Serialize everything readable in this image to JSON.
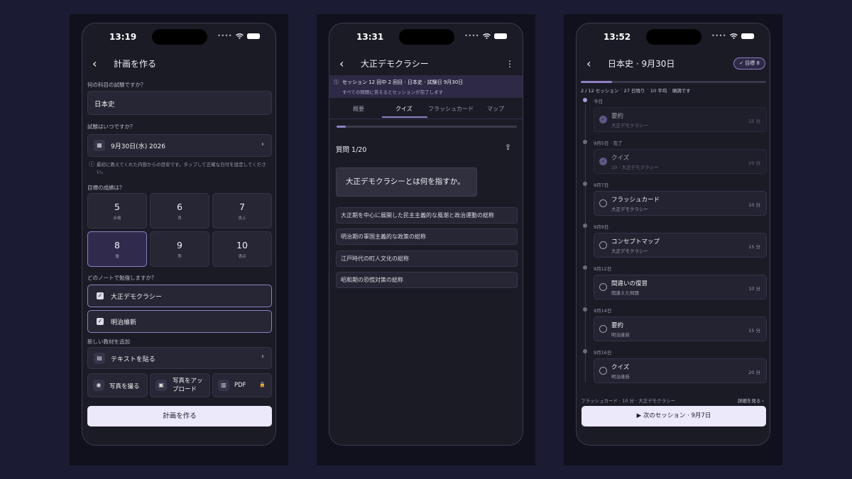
{
  "status": {
    "times": [
      "13:19",
      "13:31",
      "13:52"
    ]
  },
  "screen1": {
    "title": "計画を作る",
    "q_subject": "何の科目の試験ですか？",
    "subject_value": "日本史",
    "q_date": "試験はいつですか？",
    "date_value": "9月30日(水) 2026",
    "date_note": "最初に教えてくれた内容からの目安です。タップして正確な日付を設定してください。",
    "q_goal": "目標の成績は？",
    "grades": [
      {
        "num": "5",
        "label": "合格"
      },
      {
        "num": "6",
        "label": "良"
      },
      {
        "num": "7",
        "label": "良上"
      },
      {
        "num": "8",
        "label": "優"
      },
      {
        "num": "9",
        "label": "秀"
      },
      {
        "num": "10",
        "label": "満点"
      }
    ],
    "q_notes": "どのノートで勉強しますか？",
    "notes": [
      "大正デモクラシー",
      "明治維新"
    ],
    "add_label": "新しい教材を追加",
    "paste_text": "テキストを貼る",
    "photo_take": "写真を撮る",
    "photo_upload": "写真をアップロード",
    "pdf": "PDF",
    "create_button": "計画を作る"
  },
  "screen2": {
    "title": "大正デモクラシー",
    "banner_title": "セッション 12 回中 2 回目 · 日本史 · 試験日 9月30日",
    "banner_sub": "すべての問題に答えるとセッションが完了します",
    "tabs": [
      "概要",
      "クイズ",
      "フラッシュカード",
      "マップ"
    ],
    "progress": 0.05,
    "question_counter": "質問 1/20",
    "question": "大正デモクラシーとは何を指すか。",
    "options": [
      "大正期を中心に展開した民主主義的な風潮と政治運動の総称",
      "明治期の軍国主義的な政策の総称",
      "江戸時代の町人文化の総称",
      "昭和期の恐慌対策の総称"
    ]
  },
  "screen3": {
    "title": "日本史 · 9月30日",
    "badge": "✓ 目標 8",
    "progress": 0.167,
    "stats": "2 / 12 セッション ˙ 27 日残り ˙ 10 平均 ˙ 順調です",
    "timeline": [
      {
        "day": "今日",
        "title": "要約",
        "sub": "大正デモクラシー",
        "min": "15 分",
        "done": true
      },
      {
        "day": "9月5日 · 完了",
        "title": "クイズ",
        "sub": "10 · 大正デモクラシー",
        "min": "20 分",
        "done": true
      },
      {
        "day": "9月7日",
        "title": "フラッシュカード",
        "sub": "大正デモクラシー",
        "min": "10 分",
        "done": false
      },
      {
        "day": "9月9日",
        "title": "コンセプトマップ",
        "sub": "大正デモクラシー",
        "min": "15 分",
        "done": false
      },
      {
        "day": "9月12日",
        "title": "間違いの復習",
        "sub": "間違えた問題",
        "min": "10 分",
        "done": false
      },
      {
        "day": "9月14日",
        "title": "要約",
        "sub": "明治維新",
        "min": "15 分",
        "done": false
      },
      {
        "day": "9月16日",
        "title": "クイズ",
        "sub": "明治維新",
        "min": "20 分",
        "done": false
      }
    ],
    "footer_left": "フラッシュカード · 10 分 · 大正デモクラシー",
    "footer_right": "詳細を見る ›",
    "next_button": "▶ 次のセッション · 9月7日"
  },
  "colors": {
    "accent": "#8d80c4",
    "background": "#1b1b33",
    "card": "#262634"
  }
}
